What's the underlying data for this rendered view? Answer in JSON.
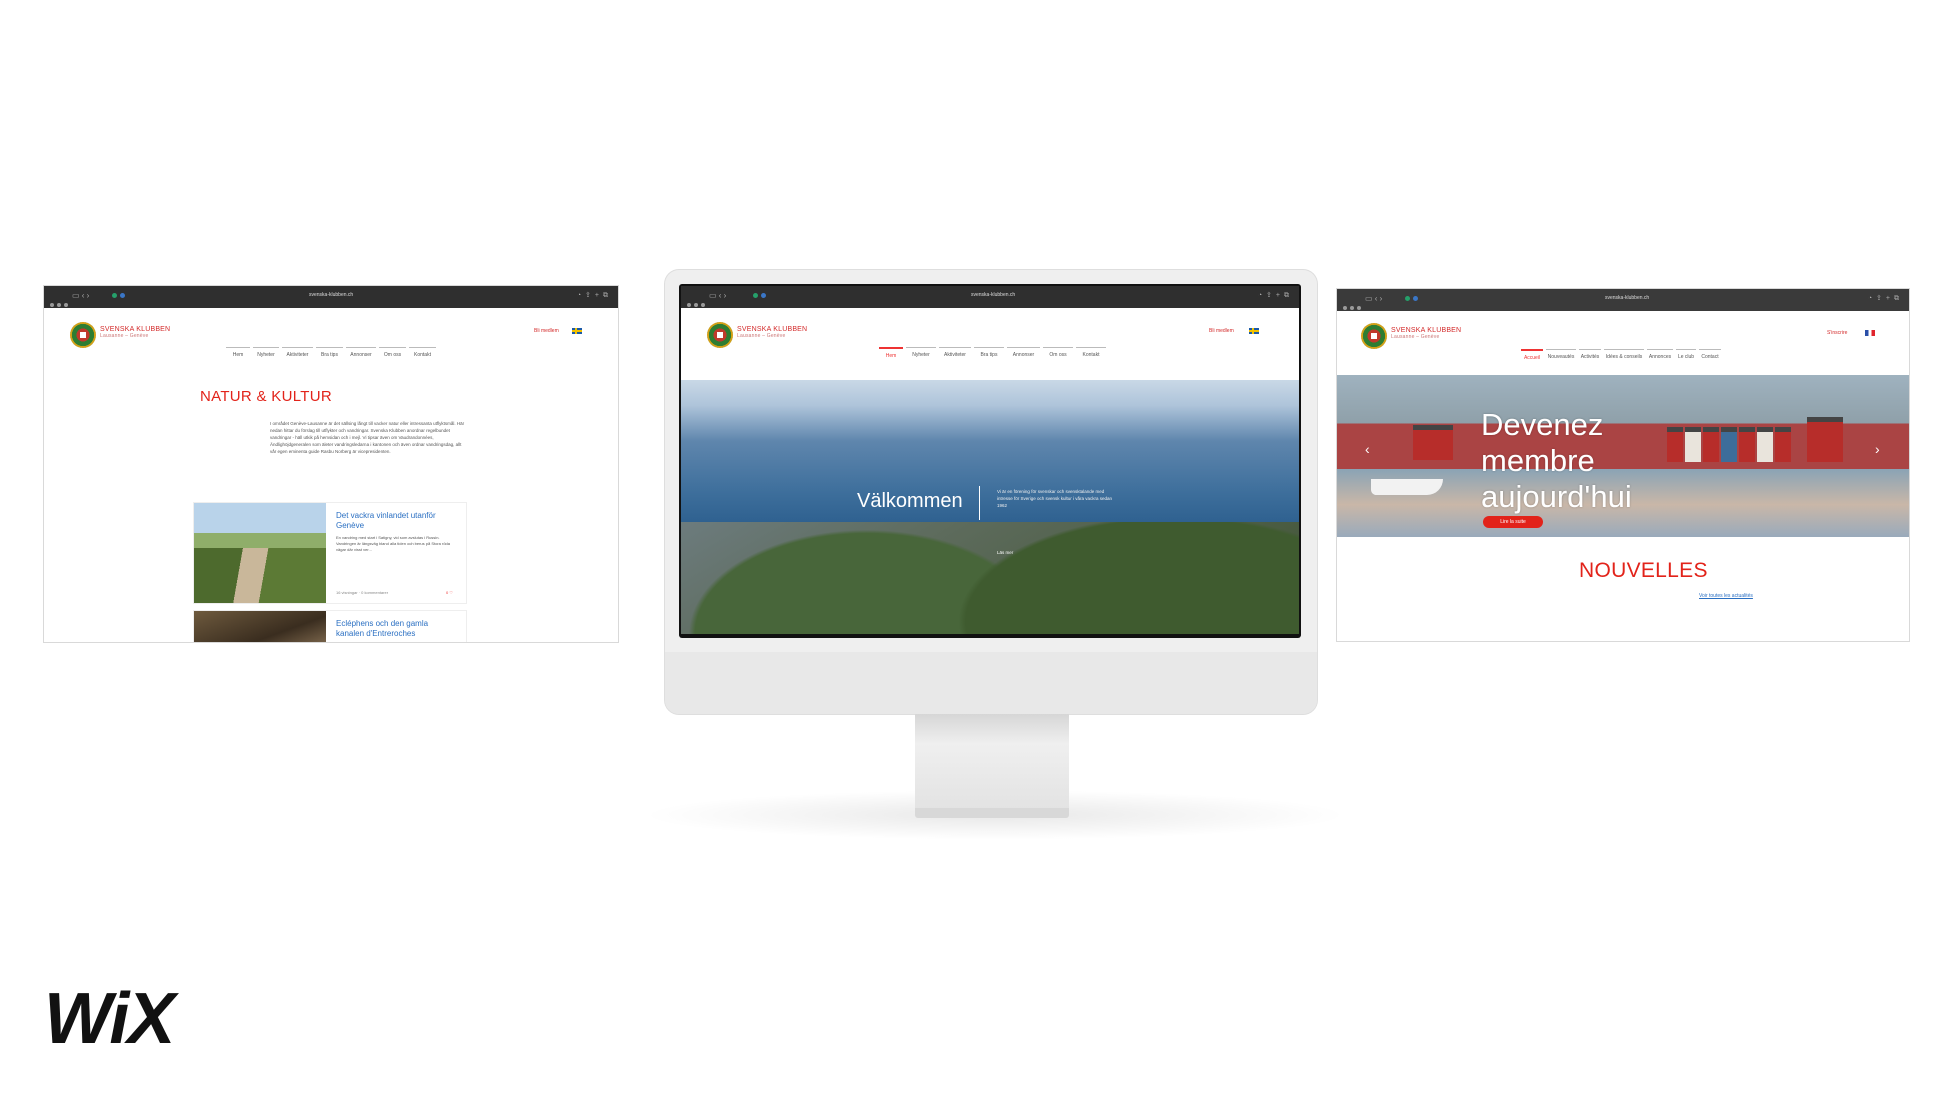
{
  "left_site": {
    "url": "svenska-klubben.ch",
    "brand": "SVENSKA KLUBBEN",
    "brand_sub": "Lausanne – Genève",
    "lang": "Bli medlem",
    "nav": [
      "Hem",
      "Nyheter",
      "Aktiviteter",
      "Bra tips",
      "Annonser",
      "Om oss",
      "Kontakt"
    ],
    "heading": "NATUR & KULTUR",
    "paragraph": "I området Genève-Lausanne är det sällsing långt till vacker natur eller intressanta utflyktsmål. Här nedan hittar du förslag till utflykter och vandringar. Svenska Klubben anordnar regelbundet vandringar - häll utkik på hemsidan och i mejl. Vi tipsar även om Vaudrandonnées, Ändlighöjdgeneralen som äleter vandringsledarna i kantonen och även ordnar vandringsdag, allt vår egen eminenta guide Rasbu Norberg är vicepresidenten.",
    "cards": [
      {
        "title": "Det vackra vinlandet utanför Genève",
        "text": "En vandring med start i Satigny, vid som avslutas i Russin. Vandringen är längsväg bland alla tiden och berus på Stora röda vägar där visst ver...",
        "meta": "16 visningar · 0 kommentarer",
        "likes": "0 ♡"
      },
      {
        "title": "Ecléphens och den gamla kanalen d'Entreroches",
        "text": "",
        "meta": "",
        "likes": ""
      }
    ]
  },
  "center_site": {
    "url": "svenska-klubben.ch",
    "brand": "SVENSKA KLUBBEN",
    "brand_sub": "Lausanne – Genève",
    "lang": "Bli medlem",
    "nav": [
      "Hem",
      "Nyheter",
      "Aktiviteter",
      "Bra tips",
      "Annonser",
      "Om oss",
      "Kontakt"
    ],
    "hero_title": "Välkommen",
    "hero_text": "Vi är en förening för svenskar och svensktalande med intresse för Sverige och svensk kultur i våra vackra sedan 1962",
    "hero_link": "Läs mer"
  },
  "right_site": {
    "url": "svenska-klubben.ch",
    "brand": "SVENSKA KLUBBEN",
    "brand_sub": "Lausanne – Genève",
    "lang": "S'inscrire",
    "nav": [
      "Accueil",
      "Nouveautés",
      "Activités",
      "Idées & conseils",
      "Annonces",
      "Le club",
      "Contact"
    ],
    "hero_line1": "Devenez",
    "hero_line2": "membre",
    "hero_line3": "aujourd'hui",
    "hero_button": "Lire la suite",
    "section_title": "NOUVELLES",
    "section_link": "Voir toutes les actualités"
  },
  "logo_text": "WiX"
}
